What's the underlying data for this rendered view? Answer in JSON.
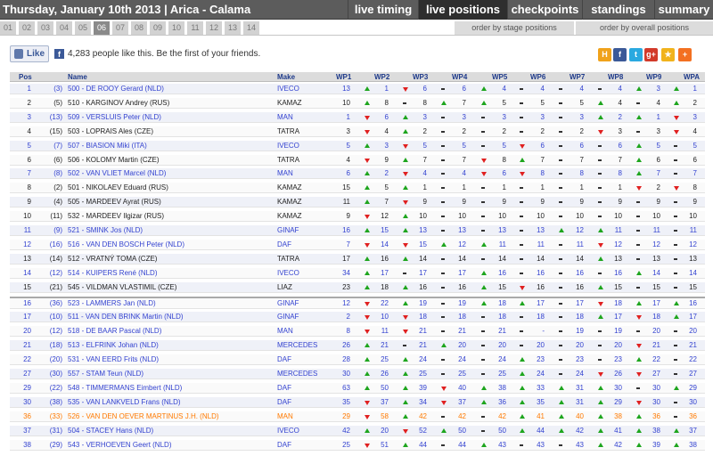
{
  "header": {
    "title": "Thursday, January 10th 2013 | Arica - Calama",
    "nav": [
      {
        "label": "live timing",
        "active": false
      },
      {
        "label": "live positions",
        "active": true
      },
      {
        "label": "checkpoints",
        "active": false
      },
      {
        "label": "standings",
        "active": false
      },
      {
        "label": "summary",
        "active": false
      }
    ]
  },
  "stages": [
    "01",
    "02",
    "03",
    "04",
    "05",
    "06",
    "07",
    "08",
    "09",
    "10",
    "11",
    "12",
    "13",
    "14"
  ],
  "active_stage": "06",
  "order_buttons": [
    "order by stage positions",
    "order by overall positions"
  ],
  "social": {
    "like_label": "Like",
    "like_text": "4,283 people like this. Be the first of your friends.",
    "fb_letter": "f",
    "share_icons": [
      {
        "name": "hyves-icon",
        "color": "#f0a21b",
        "glyph": "H"
      },
      {
        "name": "facebook-icon",
        "color": "#3b5998",
        "glyph": "f"
      },
      {
        "name": "twitter-icon",
        "color": "#2aa9e0",
        "glyph": "t"
      },
      {
        "name": "google-plus-icon",
        "color": "#d23a2a",
        "glyph": "g+"
      },
      {
        "name": "favorite-icon",
        "color": "#f1b31c",
        "glyph": "★"
      },
      {
        "name": "add-icon",
        "color": "#f37021",
        "glyph": "+"
      }
    ]
  },
  "table": {
    "columns": [
      "Pos",
      "Name",
      "Make",
      "WP1",
      "WP2",
      "WP3",
      "WP4",
      "WP5",
      "WP6",
      "WP7",
      "WP8",
      "WP9",
      "WPA"
    ],
    "rows": [
      {
        "pos": "1",
        "prev": "(3)",
        "name": "500 - DE ROOY Gerard (NLD)",
        "make": "IVECO",
        "color": "blue",
        "wp": [
          "13",
          "1",
          "6",
          "6",
          "4",
          "4",
          "4",
          "4",
          "3",
          "1"
        ],
        "tr": [
          "up",
          "down",
          "same",
          "up",
          "same",
          "same",
          "same",
          "up",
          "up"
        ]
      },
      {
        "pos": "2",
        "prev": "(5)",
        "name": "510 - KARGINOV Andrey (RUS)",
        "make": "KAMAZ",
        "color": "black",
        "wp": [
          "10",
          "8",
          "8",
          "7",
          "5",
          "5",
          "5",
          "4",
          "4",
          "2"
        ],
        "tr": [
          "up",
          "same",
          "up",
          "up",
          "same",
          "same",
          "up",
          "same",
          "up"
        ]
      },
      {
        "pos": "3",
        "prev": "(13)",
        "name": "509 - VERSLUIS Peter (NLD)",
        "make": "MAN",
        "color": "blue",
        "wp": [
          "1",
          "6",
          "3",
          "3",
          "3",
          "3",
          "3",
          "2",
          "1",
          "3"
        ],
        "tr": [
          "down",
          "up",
          "same",
          "same",
          "same",
          "same",
          "up",
          "up",
          "down"
        ]
      },
      {
        "pos": "4",
        "prev": "(15)",
        "name": "503 - LOPRAIS Ales (CZE)",
        "make": "TATRA",
        "color": "black",
        "wp": [
          "3",
          "4",
          "2",
          "2",
          "2",
          "2",
          "2",
          "3",
          "3",
          "4"
        ],
        "tr": [
          "down",
          "up",
          "same",
          "same",
          "same",
          "same",
          "down",
          "same",
          "down"
        ]
      },
      {
        "pos": "5",
        "prev": "(7)",
        "name": "507 - BIASION Miki (ITA)",
        "make": "IVECO",
        "color": "blue",
        "wp": [
          "5",
          "3",
          "5",
          "5",
          "5",
          "6",
          "6",
          "6",
          "5",
          "5"
        ],
        "tr": [
          "up",
          "down",
          "same",
          "same",
          "down",
          "same",
          "same",
          "up",
          "same"
        ]
      },
      {
        "pos": "6",
        "prev": "(6)",
        "name": "506 - KOLOMY Martin (CZE)",
        "make": "TATRA",
        "color": "black",
        "wp": [
          "4",
          "9",
          "7",
          "7",
          "8",
          "7",
          "7",
          "7",
          "6",
          "6"
        ],
        "tr": [
          "down",
          "up",
          "same",
          "down",
          "up",
          "same",
          "same",
          "up",
          "same"
        ]
      },
      {
        "pos": "7",
        "prev": "(8)",
        "name": "502 - VAN VLIET Marcel (NLD)",
        "make": "MAN",
        "color": "blue",
        "wp": [
          "6",
          "2",
          "4",
          "4",
          "6",
          "8",
          "8",
          "8",
          "7",
          "7"
        ],
        "tr": [
          "up",
          "down",
          "same",
          "down",
          "down",
          "same",
          "same",
          "up",
          "same"
        ]
      },
      {
        "pos": "8",
        "prev": "(2)",
        "name": "501 - NIKOLAEV Eduard (RUS)",
        "make": "KAMAZ",
        "color": "black",
        "wp": [
          "15",
          "5",
          "1",
          "1",
          "1",
          "1",
          "1",
          "1",
          "2",
          "8"
        ],
        "tr": [
          "up",
          "up",
          "same",
          "same",
          "same",
          "same",
          "same",
          "down",
          "down"
        ]
      },
      {
        "pos": "9",
        "prev": "(4)",
        "name": "505 - MARDEEV Ayrat (RUS)",
        "make": "KAMAZ",
        "color": "black",
        "wp": [
          "11",
          "7",
          "9",
          "9",
          "9",
          "9",
          "9",
          "9",
          "9",
          "9"
        ],
        "tr": [
          "up",
          "down",
          "same",
          "same",
          "same",
          "same",
          "same",
          "same",
          "same"
        ]
      },
      {
        "pos": "10",
        "prev": "(11)",
        "name": "532 - MARDEEV Ilgizar (RUS)",
        "make": "KAMAZ",
        "color": "black",
        "wp": [
          "9",
          "12",
          "10",
          "10",
          "10",
          "10",
          "10",
          "10",
          "10",
          "10"
        ],
        "tr": [
          "down",
          "up",
          "same",
          "same",
          "same",
          "same",
          "same",
          "same",
          "same"
        ]
      },
      {
        "pos": "11",
        "prev": "(9)",
        "name": "521 - SMINK Jos (NLD)",
        "make": "GINAF",
        "color": "blue",
        "wp": [
          "16",
          "15",
          "13",
          "13",
          "13",
          "13",
          "12",
          "11",
          "11",
          "11"
        ],
        "tr": [
          "up",
          "up",
          "same",
          "same",
          "same",
          "up",
          "up",
          "same",
          "same"
        ]
      },
      {
        "pos": "12",
        "prev": "(16)",
        "name": "516 - VAN DEN BOSCH Peter (NLD)",
        "make": "DAF",
        "color": "blue",
        "wp": [
          "7",
          "14",
          "15",
          "12",
          "11",
          "11",
          "11",
          "12",
          "12",
          "12"
        ],
        "tr": [
          "down",
          "down",
          "up",
          "up",
          "same",
          "same",
          "down",
          "same",
          "same"
        ]
      },
      {
        "pos": "13",
        "prev": "(14)",
        "name": "512 - VRATNÝ TOMA (CZE)",
        "make": "TATRA",
        "color": "black",
        "wp": [
          "17",
          "16",
          "14",
          "14",
          "14",
          "14",
          "14",
          "13",
          "13",
          "13"
        ],
        "tr": [
          "up",
          "up",
          "same",
          "same",
          "same",
          "same",
          "up",
          "same",
          "same"
        ]
      },
      {
        "pos": "14",
        "prev": "(12)",
        "name": "514 - KUIPERS René (NLD)",
        "make": "IVECO",
        "color": "blue",
        "wp": [
          "34",
          "17",
          "17",
          "17",
          "16",
          "16",
          "16",
          "16",
          "14",
          "14"
        ],
        "tr": [
          "up",
          "same",
          "same",
          "up",
          "same",
          "same",
          "same",
          "up",
          "same"
        ]
      },
      {
        "pos": "15",
        "prev": "(21)",
        "name": "545 - VILDMAN VLASTIMIL (CZE)",
        "make": "LIAZ",
        "color": "black",
        "wp": [
          "23",
          "18",
          "16",
          "16",
          "15",
          "16",
          "16",
          "15",
          "15",
          "15"
        ],
        "tr": [
          "up",
          "up",
          "same",
          "up",
          "down",
          "same",
          "up",
          "same",
          "same"
        ]
      },
      {
        "pos": "16",
        "prev": "(36)",
        "name": "523 - LAMMERS Jan (NLD)",
        "make": "GINAF",
        "color": "blue",
        "wp": [
          "12",
          "22",
          "19",
          "19",
          "18",
          "17",
          "17",
          "18",
          "17",
          "16"
        ],
        "tr": [
          "down",
          "up",
          "same",
          "up",
          "up",
          "same",
          "down",
          "up",
          "up"
        ]
      },
      {
        "pos": "17",
        "prev": "(10)",
        "name": "511 - VAN DEN BRINK Martin (NLD)",
        "make": "GINAF",
        "color": "blue",
        "wp": [
          "2",
          "10",
          "18",
          "18",
          "18",
          "18",
          "18",
          "17",
          "18",
          "17"
        ],
        "tr": [
          "down",
          "down",
          "same",
          "same",
          "same",
          "same",
          "up",
          "down",
          "up"
        ]
      },
      {
        "pos": "20",
        "prev": "(12)",
        "name": "518 - DE BAAR Pascal (NLD)",
        "make": "MAN",
        "color": "blue",
        "wp": [
          "8",
          "11",
          "21",
          "21",
          "21",
          "-",
          "19",
          "19",
          "20",
          "20"
        ],
        "tr": [
          "down",
          "down",
          "same",
          "same",
          "same",
          "same",
          "same",
          "same",
          "same"
        ]
      },
      {
        "pos": "21",
        "prev": "(18)",
        "name": "513 - ELFRINK Johan (NLD)",
        "make": "MERCEDES",
        "color": "blue",
        "wp": [
          "26",
          "21",
          "21",
          "20",
          "20",
          "20",
          "20",
          "20",
          "21",
          "21"
        ],
        "tr": [
          "up",
          "same",
          "up",
          "same",
          "same",
          "same",
          "same",
          "down",
          "same"
        ]
      },
      {
        "pos": "22",
        "prev": "(20)",
        "name": "531 - VAN EERD Frits (NLD)",
        "make": "DAF",
        "color": "blue",
        "wp": [
          "28",
          "25",
          "24",
          "24",
          "24",
          "23",
          "23",
          "23",
          "22",
          "22"
        ],
        "tr": [
          "up",
          "up",
          "same",
          "same",
          "up",
          "same",
          "same",
          "up",
          "same"
        ]
      },
      {
        "pos": "27",
        "prev": "(30)",
        "name": "557 - STAM Teun (NLD)",
        "make": "MERCEDES",
        "color": "blue",
        "wp": [
          "30",
          "26",
          "25",
          "25",
          "25",
          "24",
          "24",
          "26",
          "27",
          "27"
        ],
        "tr": [
          "up",
          "up",
          "same",
          "same",
          "up",
          "same",
          "down",
          "down",
          "same"
        ]
      },
      {
        "pos": "29",
        "prev": "(22)",
        "name": "548 - TIMMERMANS Eimbert (NLD)",
        "make": "DAF",
        "color": "blue",
        "wp": [
          "63",
          "50",
          "39",
          "40",
          "38",
          "33",
          "31",
          "30",
          "30",
          "29"
        ],
        "tr": [
          "up",
          "up",
          "down",
          "up",
          "up",
          "up",
          "up",
          "same",
          "up"
        ]
      },
      {
        "pos": "30",
        "prev": "(38)",
        "name": "535 - VAN LANKVELD Frans (NLD)",
        "make": "DAF",
        "color": "blue",
        "wp": [
          "35",
          "37",
          "34",
          "37",
          "36",
          "35",
          "31",
          "29",
          "30",
          "30"
        ],
        "tr": [
          "down",
          "up",
          "down",
          "up",
          "up",
          "up",
          "up",
          "down",
          "same"
        ]
      },
      {
        "pos": "36",
        "prev": "(33)",
        "name": "526 - VAN DEN OEVER MARTINUS J.H. (NLD)",
        "make": "MAN",
        "color": "orange",
        "wp": [
          "29",
          "58",
          "42",
          "42",
          "42",
          "41",
          "40",
          "38",
          "36",
          "36"
        ],
        "tr": [
          "down",
          "up",
          "same",
          "same",
          "up",
          "up",
          "up",
          "up",
          "same"
        ]
      },
      {
        "pos": "37",
        "prev": "(31)",
        "name": "504 - STACEY Hans (NLD)",
        "make": "IVECO",
        "color": "blue",
        "wp": [
          "42",
          "20",
          "52",
          "50",
          "50",
          "44",
          "42",
          "41",
          "38",
          "37"
        ],
        "tr": [
          "up",
          "down",
          "up",
          "same",
          "up",
          "up",
          "up",
          "up",
          "up"
        ]
      },
      {
        "pos": "38",
        "prev": "(29)",
        "name": "543 - VERHOEVEN Geert (NLD)",
        "make": "DAF",
        "color": "blue",
        "wp": [
          "25",
          "51",
          "44",
          "44",
          "43",
          "43",
          "43",
          "42",
          "39",
          "38"
        ],
        "tr": [
          "down",
          "up",
          "same",
          "up",
          "same",
          "same",
          "up",
          "up",
          "up"
        ]
      }
    ]
  }
}
